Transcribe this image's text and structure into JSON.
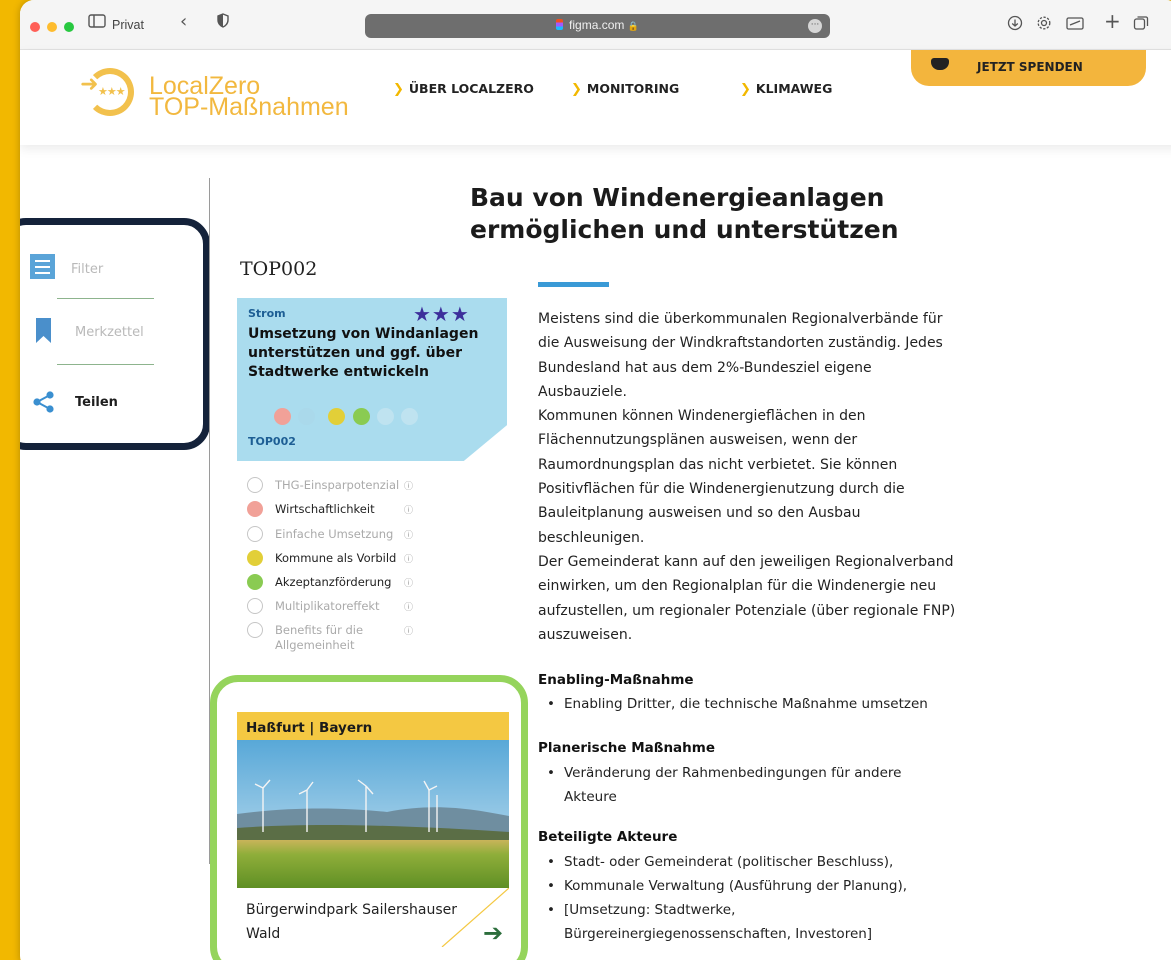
{
  "browser": {
    "profile_label": "Privat",
    "url": "figma.com",
    "lock": "🔒",
    "traffic_colors": [
      "#ff5f57",
      "#febc2e",
      "#28c840"
    ]
  },
  "header": {
    "logo_line1": "LocalZero",
    "logo_line2": "TOP-Maßnahmen",
    "nav": [
      "ÜBER LOCALZERO",
      "MONITORING",
      "KLIMAWEG"
    ],
    "donate": "JETZT SPENDEN"
  },
  "sidebar": {
    "filter": "Filter",
    "merkzettel": "Merkzettel",
    "teilen": "Teilen"
  },
  "page": {
    "title_line1": "Bau von Windenergieanlagen",
    "title_line2": "ermöglichen und unterstützen",
    "code": "TOP002"
  },
  "card": {
    "category": "Strom",
    "stars": "★★★",
    "title": "Umsetzung von Windanlagen unterstützen und ggf. über Stadtwerke entwickeln",
    "code": "TOP002",
    "dot_colors": [
      "#f1a198",
      "#e2cf38",
      "#8acb52"
    ]
  },
  "criteria": [
    {
      "label": "THG-Einsparpotenzial",
      "active": false,
      "color": "#ffffff"
    },
    {
      "label": "Wirtschaftlichkeit",
      "active": true,
      "color": "#f1a198"
    },
    {
      "label": "Einfache Umsetzung",
      "active": false,
      "color": "#ffffff"
    },
    {
      "label": "Kommune als Vorbild",
      "active": true,
      "color": "#e2cf38"
    },
    {
      "label": "Akzeptanzförderung",
      "active": true,
      "color": "#8acb52"
    },
    {
      "label": "Multiplikatoreffekt",
      "active": false,
      "color": "#ffffff"
    },
    {
      "label": "Benefits für die Allgemeinheit",
      "active": false,
      "color": "#ffffff"
    }
  ],
  "description": "Meistens sind die überkommunalen Regionalverbände für die Ausweisung der Windkraftstandorten zuständig. Jedes Bundesland hat aus dem 2%-Bundesziel eigene Ausbauziele.\nKommunen können Windenergieflächen in den Flächennutzungsplänen ausweisen, wenn der Raumordnungsplan das nicht verbietet. Sie können Positivflächen für die Windenergienutzung durch die Bauleitplanung ausweisen und so den Ausbau beschleunigen.\nDer Gemeinderat kann auf den jeweiligen Regionalverband einwirken, um den Regionalplan für die Windenergie neu aufzustellen, um regionaler Potenziale (über regionale FNP) auszuweisen.",
  "enabling": {
    "heading": "Enabling-Maßnahme",
    "items": [
      "Enabling Dritter, die technische Maßnahme umsetzen"
    ]
  },
  "planerisch": {
    "heading": "Planerische Maßnahme",
    "items": [
      "Veränderung der Rahmenbedingungen für andere Akteure"
    ]
  },
  "akteure": {
    "heading": "Beteiligte Akteure",
    "items": [
      "Stadt- oder Gemeinderat (politischer Beschluss),",
      "Kommunale Verwaltung (Ausführung der Planung),",
      "[Umsetzung: Stadtwerke, Bürgereinergiegenossenschaften, Investoren]"
    ]
  },
  "example": {
    "location": "Haßfurt | Bayern",
    "name": "Bürgerwindpark Sailershauser Wald",
    "arrow": "➔"
  },
  "colors": {
    "background": "#f2b800",
    "sidebar_frame": "#14223a",
    "example_frame": "#95d45c",
    "accent_blue": "#3a9ad6"
  }
}
